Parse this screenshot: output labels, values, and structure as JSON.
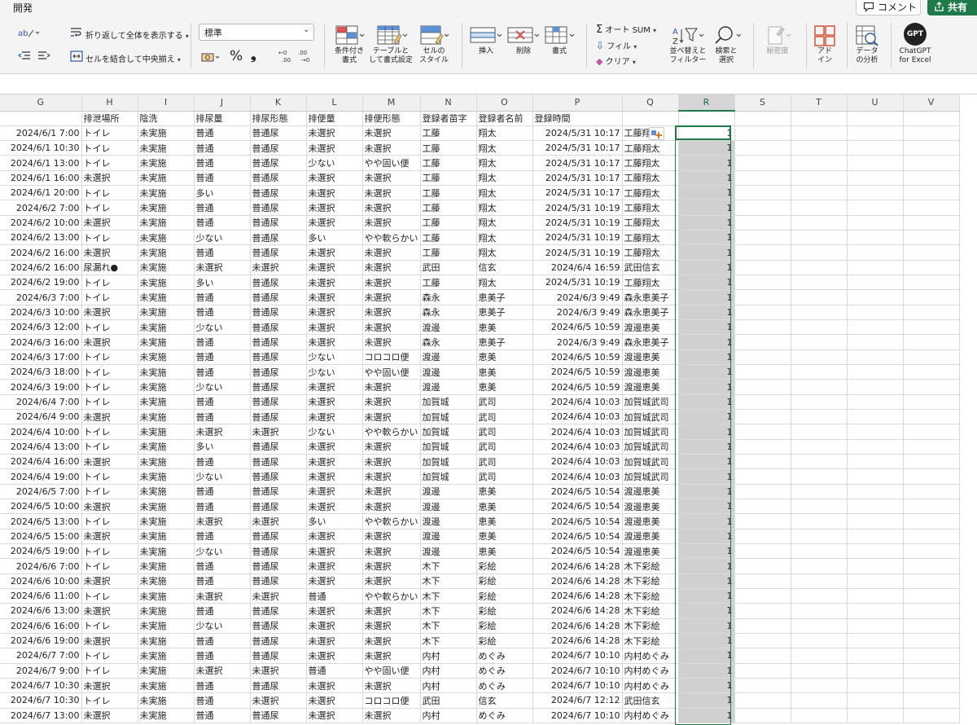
{
  "ribbon": {
    "tab_developer": "開発",
    "comment_label": "コメント",
    "share_label": "共有",
    "wrap_text_label": "折り返して全体を表示する",
    "merge_center_label": "セルを結合して中央揃え",
    "number_format_value": "標準",
    "percent_symbol": "%",
    "comma_symbol": "❟",
    "autosum_label": "オート SUM",
    "fill_label": "フィル",
    "clear_label": "クリア",
    "conditional_format": [
      "条件付き",
      "書式"
    ],
    "format_as_table": [
      "テーブルと",
      "して書式設定"
    ],
    "cell_styles": [
      "セルの",
      "スタイル"
    ],
    "insert_label": "挿入",
    "delete_label": "削除",
    "format_label": "書式",
    "sort_filter": [
      "並べ替えと",
      "フィルター"
    ],
    "find_select": [
      "検索と",
      "選択"
    ],
    "sensitivity_label": "秘密度",
    "addins": [
      "アド",
      "イン"
    ],
    "data_analysis": [
      "データ",
      "の分析"
    ],
    "chatgpt_icon_text": "GPT",
    "chatgpt": [
      "ChatGPT",
      "for Excel"
    ],
    "accent": "#1f7a4a"
  },
  "columns": [
    "G",
    "H",
    "I",
    "J",
    "K",
    "L",
    "M",
    "N",
    "O",
    "P",
    "Q",
    "R",
    "S",
    "T",
    "U",
    "V"
  ],
  "selected_column": "R",
  "header_row": [
    "",
    "排泄場所",
    "陰洗",
    "排尿量",
    "排尿形態",
    "排便量",
    "排便形態",
    "登録者苗字",
    "登録者名前",
    "登録時間",
    "",
    "",
    "",
    "",
    "",
    ""
  ],
  "rows": [
    [
      "2024/6/1 7:00",
      "トイレ",
      "未実施",
      "普通",
      "普通尿",
      "未選択",
      "未選択",
      "工藤",
      "翔太",
      "2024/5/31 10:17",
      "工藤翔太",
      "1"
    ],
    [
      "2024/6/1 10:30",
      "トイレ",
      "未実施",
      "普通",
      "普通尿",
      "未選択",
      "未選択",
      "工藤",
      "翔太",
      "2024/5/31 10:17",
      "工藤翔太",
      "1"
    ],
    [
      "2024/6/1 13:00",
      "トイレ",
      "未実施",
      "普通",
      "普通尿",
      "少ない",
      "やや固い便",
      "工藤",
      "翔太",
      "2024/5/31 10:17",
      "工藤翔太",
      "1"
    ],
    [
      "2024/6/1 16:00",
      "未選択",
      "未実施",
      "普通",
      "普通尿",
      "未選択",
      "未選択",
      "工藤",
      "翔太",
      "2024/5/31 10:17",
      "工藤翔太",
      "1"
    ],
    [
      "2024/6/1 20:00",
      "トイレ",
      "未実施",
      "多い",
      "普通尿",
      "未選択",
      "未選択",
      "工藤",
      "翔太",
      "2024/5/31 10:17",
      "工藤翔太",
      "1"
    ],
    [
      "2024/6/2 7:00",
      "トイレ",
      "未実施",
      "普通",
      "普通尿",
      "未選択",
      "未選択",
      "工藤",
      "翔太",
      "2024/5/31 10:19",
      "工藤翔太",
      "1"
    ],
    [
      "2024/6/2 10:00",
      "未選択",
      "未実施",
      "普通",
      "普通尿",
      "未選択",
      "未選択",
      "工藤",
      "翔太",
      "2024/5/31 10:19",
      "工藤翔太",
      "1"
    ],
    [
      "2024/6/2 13:00",
      "トイレ",
      "未実施",
      "少ない",
      "普通尿",
      "多い",
      "やや軟らかい",
      "工藤",
      "翔太",
      "2024/5/31 10:19",
      "工藤翔太",
      "1"
    ],
    [
      "2024/6/2 16:00",
      "未選択",
      "未実施",
      "普通",
      "普通尿",
      "未選択",
      "未選択",
      "工藤",
      "翔太",
      "2024/5/31 10:19",
      "工藤翔太",
      "1"
    ],
    [
      "2024/6/2 16:00",
      "尿漏れ●",
      "未実施",
      "未選択",
      "未選択",
      "未選択",
      "未選択",
      "武田",
      "信玄",
      "2024/6/4 16:59",
      "武田信玄",
      "1"
    ],
    [
      "2024/6/2 19:00",
      "トイレ",
      "未実施",
      "多い",
      "普通尿",
      "未選択",
      "未選択",
      "工藤",
      "翔太",
      "2024/5/31 10:19",
      "工藤翔太",
      "1"
    ],
    [
      "2024/6/3 7:00",
      "トイレ",
      "未実施",
      "普通",
      "普通尿",
      "未選択",
      "未選択",
      "森永",
      "恵美子",
      "2024/6/3 9:49",
      "森永恵美子",
      "1"
    ],
    [
      "2024/6/3 10:00",
      "未選択",
      "未実施",
      "普通",
      "普通尿",
      "未選択",
      "未選択",
      "森永",
      "恵美子",
      "2024/6/3 9:49",
      "森永恵美子",
      "1"
    ],
    [
      "2024/6/3 12:00",
      "トイレ",
      "未実施",
      "少ない",
      "普通尿",
      "未選択",
      "未選択",
      "渡邊",
      "恵美",
      "2024/6/5 10:59",
      "渡邊恵美",
      "1"
    ],
    [
      "2024/6/3 16:00",
      "未選択",
      "未実施",
      "普通",
      "普通尿",
      "未選択",
      "未選択",
      "森永",
      "恵美子",
      "2024/6/3 9:49",
      "森永恵美子",
      "1"
    ],
    [
      "2024/6/3 17:00",
      "トイレ",
      "未実施",
      "普通",
      "普通尿",
      "少ない",
      "コロコロ便",
      "渡邊",
      "恵美",
      "2024/6/5 10:59",
      "渡邊恵美",
      "1"
    ],
    [
      "2024/6/3 18:00",
      "トイレ",
      "未実施",
      "普通",
      "普通尿",
      "少ない",
      "やや固い便",
      "渡邊",
      "恵美",
      "2024/6/5 10:59",
      "渡邊恵美",
      "1"
    ],
    [
      "2024/6/3 19:00",
      "トイレ",
      "未実施",
      "少ない",
      "普通尿",
      "未選択",
      "未選択",
      "渡邊",
      "恵美",
      "2024/6/5 10:59",
      "渡邊恵美",
      "1"
    ],
    [
      "2024/6/4 7:00",
      "トイレ",
      "未実施",
      "普通",
      "普通尿",
      "未選択",
      "未選択",
      "加賀城",
      "武司",
      "2024/6/4 10:03",
      "加賀城武司",
      "1"
    ],
    [
      "2024/6/4 9:00",
      "未選択",
      "未実施",
      "普通",
      "普通尿",
      "未選択",
      "未選択",
      "加賀城",
      "武司",
      "2024/6/4 10:03",
      "加賀城武司",
      "1"
    ],
    [
      "2024/6/4 10:00",
      "トイレ",
      "未実施",
      "未選択",
      "未選択",
      "少ない",
      "やや軟らかい",
      "加賀城",
      "武司",
      "2024/6/4 10:03",
      "加賀城武司",
      "1"
    ],
    [
      "2024/6/4 13:00",
      "トイレ",
      "未実施",
      "多い",
      "普通尿",
      "未選択",
      "未選択",
      "加賀城",
      "武司",
      "2024/6/4 10:03",
      "加賀城武司",
      "1"
    ],
    [
      "2024/6/4 16:00",
      "未選択",
      "未実施",
      "普通",
      "普通尿",
      "未選択",
      "未選択",
      "加賀城",
      "武司",
      "2024/6/4 10:03",
      "加賀城武司",
      "1"
    ],
    [
      "2024/6/4 19:00",
      "トイレ",
      "未実施",
      "少ない",
      "普通尿",
      "未選択",
      "未選択",
      "加賀城",
      "武司",
      "2024/6/4 10:03",
      "加賀城武司",
      "1"
    ],
    [
      "2024/6/5 7:00",
      "トイレ",
      "未実施",
      "普通",
      "普通尿",
      "未選択",
      "未選択",
      "渡邊",
      "恵美",
      "2024/6/5 10:54",
      "渡邊恵美",
      "1"
    ],
    [
      "2024/6/5 10:00",
      "未選択",
      "未実施",
      "普通",
      "普通尿",
      "未選択",
      "未選択",
      "渡邊",
      "恵美",
      "2024/6/5 10:54",
      "渡邊恵美",
      "1"
    ],
    [
      "2024/6/5 13:00",
      "トイレ",
      "未実施",
      "未選択",
      "未選択",
      "多い",
      "やや軟らかい",
      "渡邊",
      "恵美",
      "2024/6/5 10:54",
      "渡邊恵美",
      "1"
    ],
    [
      "2024/6/5 15:00",
      "未選択",
      "未実施",
      "普通",
      "普通尿",
      "未選択",
      "未選択",
      "渡邊",
      "恵美",
      "2024/6/5 10:54",
      "渡邊恵美",
      "1"
    ],
    [
      "2024/6/5 19:00",
      "トイレ",
      "未実施",
      "少ない",
      "普通尿",
      "未選択",
      "未選択",
      "渡邊",
      "恵美",
      "2024/6/5 10:54",
      "渡邊恵美",
      "1"
    ],
    [
      "2024/6/6 7:00",
      "トイレ",
      "未実施",
      "普通",
      "普通尿",
      "未選択",
      "未選択",
      "木下",
      "彩絵",
      "2024/6/6 14:28",
      "木下彩絵",
      "1"
    ],
    [
      "2024/6/6 10:00",
      "未選択",
      "未実施",
      "普通",
      "普通尿",
      "未選択",
      "未選択",
      "木下",
      "彩絵",
      "2024/6/6 14:28",
      "木下彩絵",
      "1"
    ],
    [
      "2024/6/6 11:00",
      "トイレ",
      "未実施",
      "未選択",
      "未選択",
      "普通",
      "やや軟らかい",
      "木下",
      "彩絵",
      "2024/6/6 14:28",
      "木下彩絵",
      "1"
    ],
    [
      "2024/6/6 13:00",
      "未選択",
      "未実施",
      "普通",
      "普通尿",
      "未選択",
      "未選択",
      "木下",
      "彩絵",
      "2024/6/6 14:28",
      "木下彩絵",
      "1"
    ],
    [
      "2024/6/6 16:00",
      "トイレ",
      "未実施",
      "少ない",
      "普通尿",
      "未選択",
      "未選択",
      "木下",
      "彩絵",
      "2024/6/6 14:28",
      "木下彩絵",
      "1"
    ],
    [
      "2024/6/6 19:00",
      "未選択",
      "未実施",
      "普通",
      "普通尿",
      "未選択",
      "未選択",
      "木下",
      "彩絵",
      "2024/6/6 14:28",
      "木下彩絵",
      "1"
    ],
    [
      "2024/6/7 7:00",
      "トイレ",
      "未実施",
      "普通",
      "普通尿",
      "未選択",
      "未選択",
      "内村",
      "めぐみ",
      "2024/6/7 10:10",
      "内村めぐみ",
      "1"
    ],
    [
      "2024/6/7 9:00",
      "トイレ",
      "未実施",
      "未選択",
      "未選択",
      "普通",
      "やや固い便",
      "内村",
      "めぐみ",
      "2024/6/7 10:10",
      "内村めぐみ",
      "1"
    ],
    [
      "2024/6/7 10:30",
      "未選択",
      "未実施",
      "普通",
      "普通尿",
      "未選択",
      "未選択",
      "内村",
      "めぐみ",
      "2024/6/7 10:10",
      "内村めぐみ",
      "1"
    ],
    [
      "2024/6/7 10:30",
      "トイレ",
      "未実施",
      "普通",
      "未選択",
      "未選択",
      "コロコロ便",
      "武田",
      "信玄",
      "2024/6/7 12:12",
      "武田信玄",
      "1"
    ],
    [
      "2024/6/7 13:00",
      "未選択",
      "未実施",
      "普通",
      "普通尿",
      "未選択",
      "未選択",
      "内村",
      "めぐみ",
      "2024/6/7 10:10",
      "内村めぐみ",
      "1"
    ]
  ]
}
